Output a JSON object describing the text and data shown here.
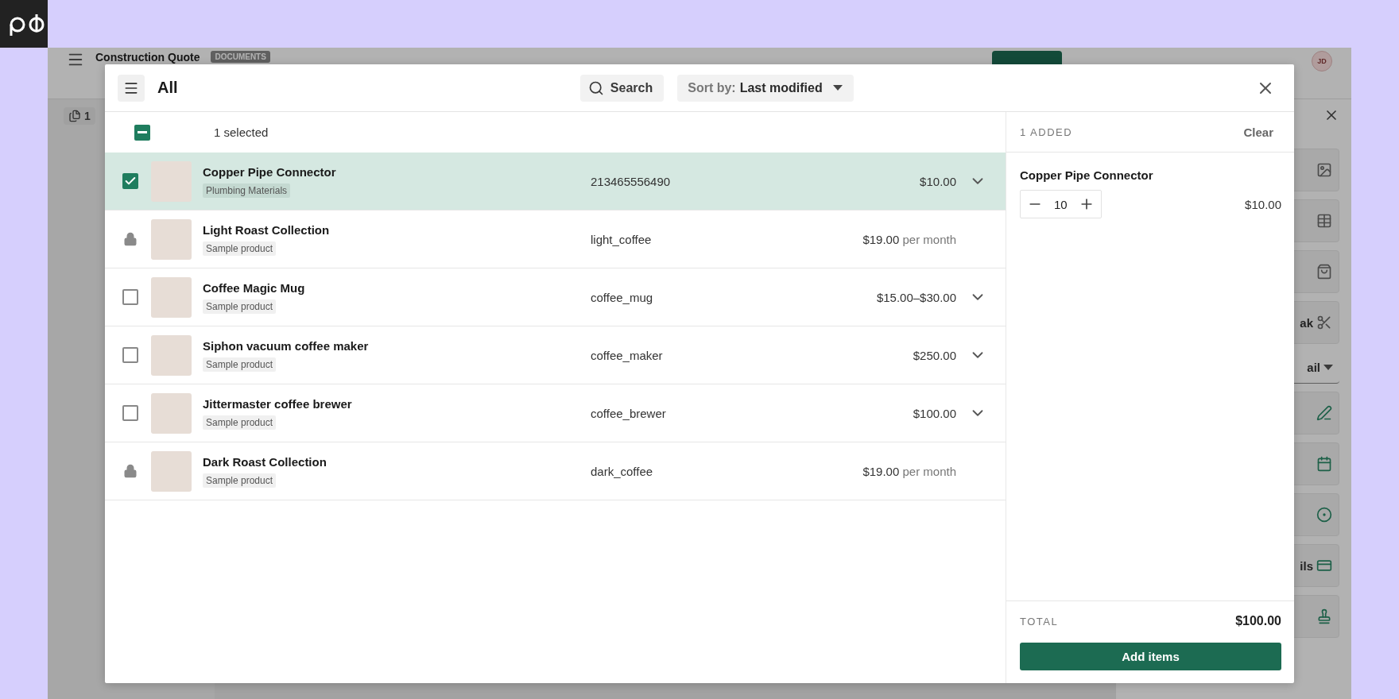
{
  "background_app": {
    "title": "Construction Quote",
    "badge": "DOCUMENTS",
    "page_count": "1",
    "avatar": "JD",
    "side_cards": [
      {
        "kind": "image"
      },
      {
        "kind": "table"
      },
      {
        "kind": "bag"
      },
      {
        "kind": "scissors",
        "text": "ak"
      },
      {
        "kind": "dropdown",
        "text": "ail"
      },
      {
        "kind": "signature"
      },
      {
        "kind": "calendar"
      },
      {
        "kind": "radio"
      },
      {
        "kind": "card",
        "text": "ils"
      },
      {
        "kind": "stamp"
      }
    ]
  },
  "modal": {
    "title": "All",
    "search_label": "Search",
    "sort_label": "Sort by:",
    "sort_value": "Last modified",
    "select_all_indeterminate": true,
    "selected_count": "1 selected",
    "products": [
      {
        "name": "Copper Pipe Connector",
        "tag": "Plumbing Materials",
        "sku": "213465556490",
        "price": "$10.00",
        "kind": "checkbox",
        "selected": true,
        "expandable": true
      },
      {
        "name": "Light Roast Collection",
        "tag": "Sample product",
        "sku": "light_coffee",
        "price": "$19.00",
        "price_suffix": "per month",
        "kind": "locked",
        "selected": false,
        "expandable": false
      },
      {
        "name": "Coffee Magic Mug",
        "tag": "Sample product",
        "sku": "coffee_mug",
        "price": "$15.00–$30.00",
        "kind": "checkbox",
        "selected": false,
        "expandable": true
      },
      {
        "name": "Siphon vacuum coffee maker",
        "tag": "Sample product",
        "sku": "coffee_maker",
        "price": "$250.00",
        "kind": "checkbox",
        "selected": false,
        "expandable": true
      },
      {
        "name": "Jittermaster coffee brewer",
        "tag": "Sample product",
        "sku": "coffee_brewer",
        "price": "$100.00",
        "kind": "checkbox",
        "selected": false,
        "expandable": true
      },
      {
        "name": "Dark Roast Collection",
        "tag": "Sample product",
        "sku": "dark_coffee",
        "price": "$19.00",
        "price_suffix": "per month",
        "kind": "locked",
        "selected": false,
        "expandable": false
      }
    ],
    "cart": {
      "count_label": "1 ADDED",
      "clear_label": "Clear",
      "items": [
        {
          "name": "Copper Pipe Connector",
          "quantity": "10",
          "price": "$10.00"
        }
      ],
      "total_label": "TOTAL",
      "total": "$100.00",
      "submit_label": "Add items"
    }
  }
}
